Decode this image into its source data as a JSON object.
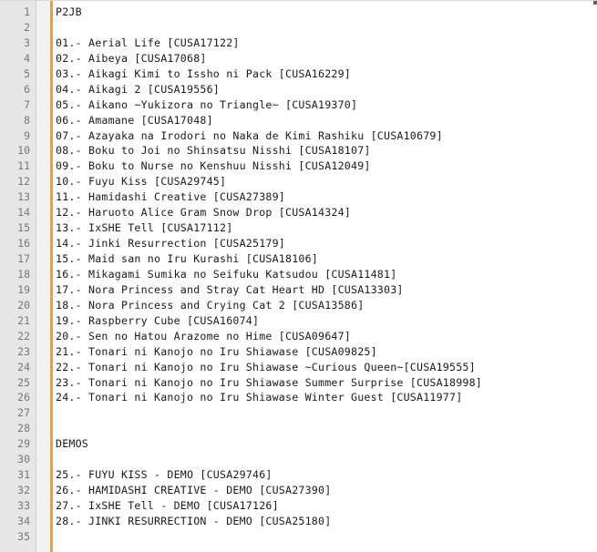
{
  "editor": {
    "lines": [
      {
        "n": "1",
        "text": "P2JB"
      },
      {
        "n": "2",
        "text": ""
      },
      {
        "n": "3",
        "text": "01.- Aerial Life [CUSA17122]"
      },
      {
        "n": "4",
        "text": "02.- Aibeya [CUSA17068]"
      },
      {
        "n": "5",
        "text": "03.- Aikagi Kimi to Issho ni Pack [CUSA16229]"
      },
      {
        "n": "6",
        "text": "04.- Aikagi 2 [CUSA19556]"
      },
      {
        "n": "7",
        "text": "05.- Aikano ~Yukizora no Triangle~ [CUSA19370]"
      },
      {
        "n": "8",
        "text": "06.- Amamane [CUSA17048]"
      },
      {
        "n": "9",
        "text": "07.- Azayaka na Irodori no Naka de Kimi Rashiku [CUSA10679]"
      },
      {
        "n": "10",
        "text": "08.- Boku to Joi no Shinsatsu Nisshi [CUSA18107]"
      },
      {
        "n": "11",
        "text": "09.- Boku to Nurse no Kenshuu Nisshi [CUSA12049]"
      },
      {
        "n": "12",
        "text": "10.- Fuyu Kiss [CUSA29745]"
      },
      {
        "n": "13",
        "text": "11.- Hamidashi Creative [CUSA27389]"
      },
      {
        "n": "14",
        "text": "12.- Haruoto Alice Gram Snow Drop [CUSA14324]"
      },
      {
        "n": "15",
        "text": "13.- IxSHE Tell [CUSA17112]"
      },
      {
        "n": "16",
        "text": "14.- Jinki Resurrection [CUSA25179]"
      },
      {
        "n": "17",
        "text": "15.- Maid san no Iru Kurashi [CUSA18106]"
      },
      {
        "n": "18",
        "text": "16.- Mikagami Sumika no Seifuku Katsudou [CUSA11481]"
      },
      {
        "n": "19",
        "text": "17.- Nora Princess and Stray Cat Heart HD [CUSA13303]"
      },
      {
        "n": "20",
        "text": "18.- Nora Princess and Crying Cat 2 [CUSA13586]"
      },
      {
        "n": "21",
        "text": "19.- Raspberry Cube [CUSA16074]"
      },
      {
        "n": "22",
        "text": "20.- Sen no Hatou Arazome no Hime [CUSA09647]"
      },
      {
        "n": "23",
        "text": "21.- Tonari ni Kanojo no Iru Shiawase [CUSA09825]"
      },
      {
        "n": "24",
        "text": "22.- Tonari ni Kanojo no Iru Shiawase ~Curious Queen~[CUSA19555]"
      },
      {
        "n": "25",
        "text": "23.- Tonari ni Kanojo no Iru Shiawase Summer Surprise [CUSA18998]"
      },
      {
        "n": "26",
        "text": "24.- Tonari ni Kanojo no Iru Shiawase Winter Guest [CUSA11977]"
      },
      {
        "n": "27",
        "text": ""
      },
      {
        "n": "28",
        "text": ""
      },
      {
        "n": "29",
        "text": "DEMOS"
      },
      {
        "n": "30",
        "text": ""
      },
      {
        "n": "31",
        "text": "25.- FUYU KISS - DEMO [CUSA29746]"
      },
      {
        "n": "32",
        "text": "26.- HAMIDASHI CREATIVE - DEMO [CUSA27390]"
      },
      {
        "n": "33",
        "text": "27.- IxSHE Tell - DEMO [CUSA17126]"
      },
      {
        "n": "34",
        "text": "28.- JINKI RESURRECTION - DEMO [CUSA25180]"
      },
      {
        "n": "35",
        "text": ""
      }
    ],
    "colors": {
      "gutter": "#e6e6e6",
      "caret_line": "#f0a030",
      "text": "#1a1a1a",
      "line_number": "#777777"
    }
  }
}
